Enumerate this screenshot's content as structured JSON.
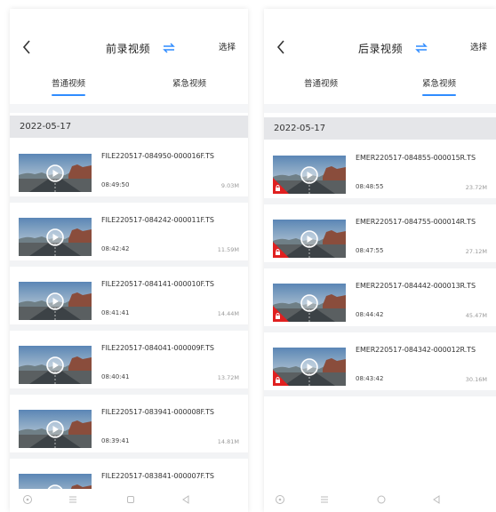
{
  "left": {
    "title": "前录视频",
    "select_label": "选择",
    "tabs": [
      {
        "label": "普通视频",
        "active": true
      },
      {
        "label": "紧急视频",
        "active": false
      }
    ],
    "date": "2022-05-17",
    "items": [
      {
        "name": "FILE220517-084950-000016F.TS",
        "time": "08:49:50",
        "size": "9.03M"
      },
      {
        "name": "FILE220517-084242-000011F.TS",
        "time": "08:42:42",
        "size": "11.59M"
      },
      {
        "name": "FILE220517-084141-000010F.TS",
        "time": "08:41:41",
        "size": "14.44M"
      },
      {
        "name": "FILE220517-084041-000009F.TS",
        "time": "08:40:41",
        "size": "13.72M"
      },
      {
        "name": "FILE220517-083941-000008F.TS",
        "time": "08:39:41",
        "size": "14.81M"
      },
      {
        "name": "FILE220517-083841-000007F.TS",
        "time": "",
        "size": ""
      }
    ]
  },
  "right": {
    "title": "后录视频",
    "select_label": "选择",
    "tabs": [
      {
        "label": "普通视频",
        "active": false
      },
      {
        "label": "紧急视频",
        "active": true
      }
    ],
    "date": "2022-05-17",
    "items": [
      {
        "name": "EMER220517-084855-000015R.TS",
        "time": "08:48:55",
        "size": "23.72M"
      },
      {
        "name": "EMER220517-084755-000014R.TS",
        "time": "08:47:55",
        "size": "27.12M"
      },
      {
        "name": "EMER220517-084442-000013R.TS",
        "time": "08:44:42",
        "size": "45.47M"
      },
      {
        "name": "EMER220517-084342-000012R.TS",
        "time": "08:43:42",
        "size": "30.16M"
      }
    ]
  },
  "icons": {
    "back": "chevron-left-icon",
    "switch": "swap-icon",
    "play": "play-icon",
    "lock": "lock-icon"
  },
  "colors": {
    "accent": "#2f8cff",
    "emergency_badge": "#e02020",
    "date_bar": "#e5e6e9"
  }
}
